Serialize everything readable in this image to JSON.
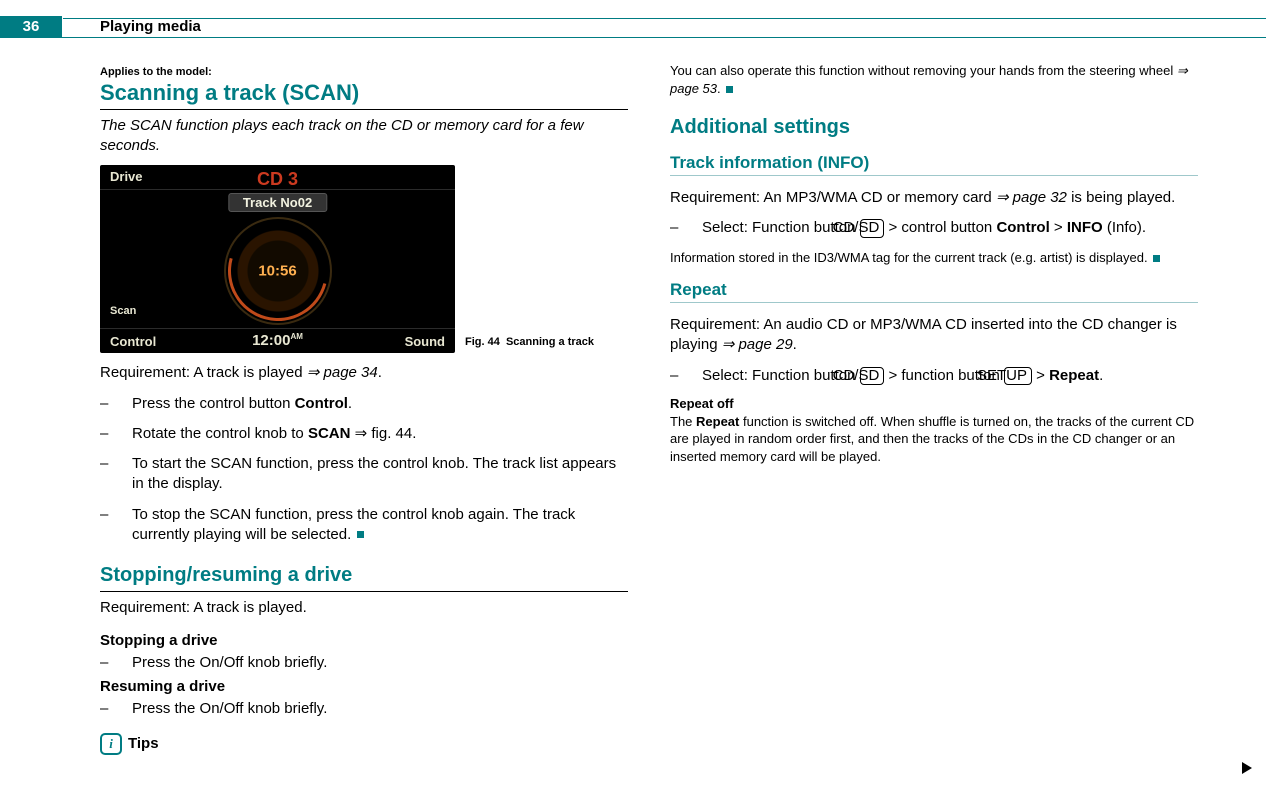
{
  "header": {
    "page_number": "36",
    "chapter": "Playing media"
  },
  "left": {
    "applies": "Applies to the model:",
    "h1": "Scanning a track (SCAN)",
    "intro": "The SCAN function plays each track on the CD or memory card for a few seconds.",
    "fig": {
      "drive": "Drive",
      "cd": "CD 3",
      "track": "Track No02",
      "dial_time": "10:56",
      "scan": "Scan",
      "control": "Control",
      "time": "12:00",
      "time_suffix": "AM",
      "sound": "Sound",
      "caption_prefix": "Fig. 44",
      "caption_text": "Scanning a track"
    },
    "req_prefix": "Requirement: A track is played ",
    "req_ref": "⇒ page 34",
    "req_suffix": ".",
    "step1_a": "Press the control button ",
    "step1_b": "Control",
    "step1_c": ".",
    "step2_a": "Rotate the control knob to ",
    "step2_b": "SCAN",
    "step2_c": " ⇒ fig. 44.",
    "step3": "To start the SCAN function, press the control knob. The track list appears in the display.",
    "step4": "To stop the SCAN function, press the control knob again. The track currently playing will be selected.",
    "h2": "Stopping/resuming a drive",
    "req2": "Requirement: A track is played.",
    "h4a": "Stopping a drive",
    "stepA": "Press the On/Off knob briefly."
  },
  "right": {
    "h4b": "Resuming a drive",
    "stepB": "Press the On/Off knob briefly.",
    "tips_label": "Tips",
    "tips_text_a": "You can also operate this function without removing your hands from the steering wheel ",
    "tips_ref": "⇒ page 53",
    "tips_text_b": ".",
    "h2": "Additional settings",
    "topic1": "Track information (INFO)",
    "t1_req_a": "Requirement: An MP3/WMA CD or memory card ",
    "t1_req_ref": "⇒ page 32",
    "t1_req_b": " is being played.",
    "t1_step_a": "Select: Function button ",
    "t1_step_btn": "CD/SD",
    "t1_step_b": " > control button ",
    "t1_step_bold1": "Control",
    "t1_step_c": " > ",
    "t1_step_bold2": "INFO",
    "t1_step_d": " (Info).",
    "t1_note": "Information stored in the ID3/WMA tag for the current track (e.g. artist) is displayed.",
    "topic2": "Repeat",
    "t2_req_a": "Requirement: An audio CD or MP3/WMA CD inserted into the CD changer is playing ",
    "t2_req_ref": "⇒ page 29",
    "t2_req_b": ".",
    "t2_step_a": "Select: Function button ",
    "t2_step_btn1": "CD/SD",
    "t2_step_b": " > function button ",
    "t2_step_btn2": "SETUP",
    "t2_step_c": " > ",
    "t2_step_bold": "Repeat",
    "t2_step_d": ".",
    "h5": "Repeat off",
    "t2_note_a": "The ",
    "t2_note_bold": "Repeat",
    "t2_note_b": " function is switched off. When shuffle is turned on, the tracks of the current CD are played in random order first, and then the tracks of the CDs in the CD changer or an inserted memory card will be played."
  }
}
